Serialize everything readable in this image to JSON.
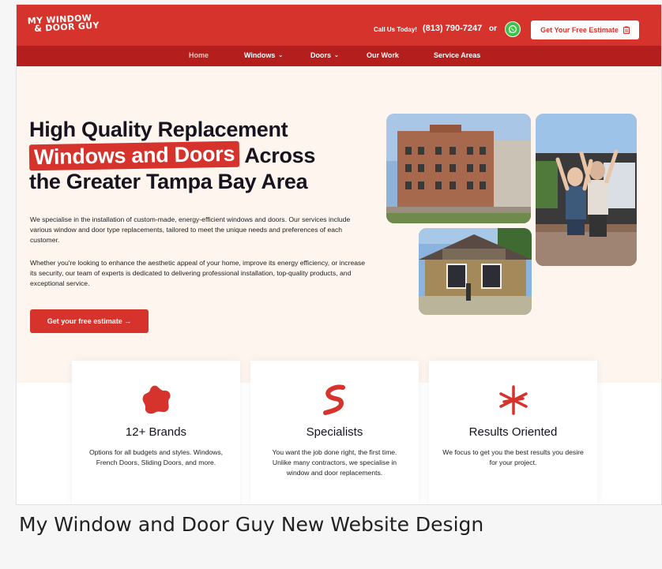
{
  "header": {
    "logo_line1": "MY WINDOW",
    "logo_line2": "& DOOR GUY",
    "call_label": "Call Us Today!",
    "phone": "(813) 790-7247",
    "or_label": "or",
    "whatsapp_icon": "whatsapp-icon",
    "estimate_button": "Get Your Free Estimate",
    "estimate_icon": "clipboard-icon"
  },
  "nav": {
    "items": [
      {
        "label": "Home",
        "dropdown": false
      },
      {
        "label": "Windows",
        "dropdown": true
      },
      {
        "label": "Doors",
        "dropdown": true
      },
      {
        "label": "Our Work",
        "dropdown": false
      },
      {
        "label": "Service Areas",
        "dropdown": false
      }
    ],
    "chevron": "⌄"
  },
  "hero": {
    "title_line1": "High Quality Replacement",
    "title_highlight": "Windows and Doors",
    "title_line2_rest": "Across",
    "title_line3": "the Greater Tampa Bay Area",
    "paragraph1": "We specialise in the installation of custom-made, energy-efficient windows and doors. Our services include various window and door type replacements, tailored to meet the unique needs and preferences of each customer.",
    "paragraph2": "Whether you're looking to enhance the aesthetic appeal of your home, improve its energy efficiency, or increase its security, our team of experts is dedicated to delivering professional installation, top-quality products, and exceptional service.",
    "cta": "Get your free estimate →"
  },
  "cards": [
    {
      "icon": "blob-icon",
      "title": "12+ Brands",
      "description": "Options for all budgets and styles. Windows, French Doors, Sliding Doors, and more."
    },
    {
      "icon": "squiggle-icon",
      "title": "Specialists",
      "description": "You want the job done right, the first time. Unlike many contractors, we specialise in window and door replacements."
    },
    {
      "icon": "asterisk-icon",
      "title": "Results Oriented",
      "description": "We focus to get you the best results you desire for your project."
    }
  ],
  "caption": "My Window and Door Guy New Website Design",
  "colors": {
    "brand_red": "#d6332c",
    "nav_red": "#b41e1c",
    "hero_bg": "#fdf5ee"
  }
}
